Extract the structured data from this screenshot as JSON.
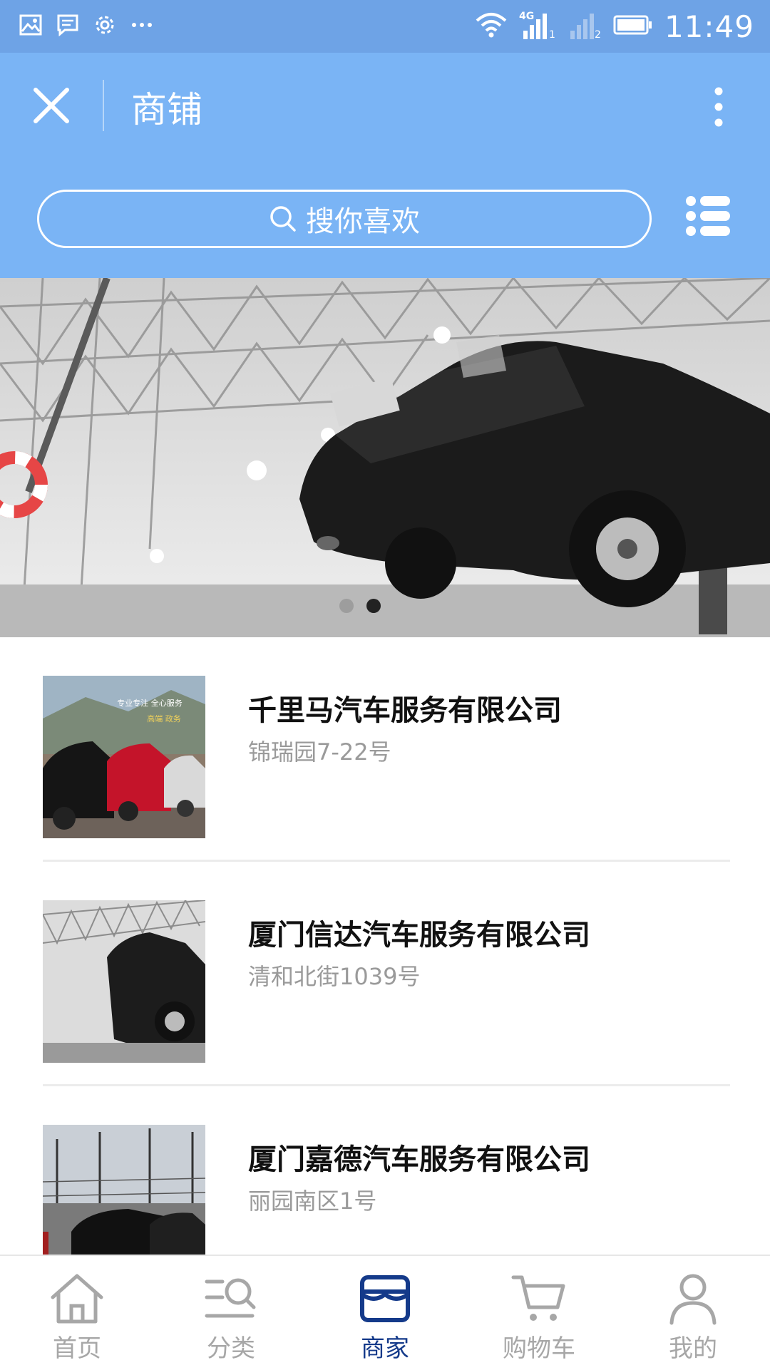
{
  "status_bar": {
    "time": "11:49",
    "network": "4G",
    "sim1": "1",
    "sim2": "2",
    "left_icons": [
      "image-icon",
      "message-icon",
      "gear-icon",
      "more-dots-icon"
    ]
  },
  "header": {
    "title": "商铺",
    "search_placeholder": "搜你喜欢",
    "colors": {
      "header_bg": "#7ab4f5",
      "status_bg": "#6ea3e6"
    }
  },
  "banner": {
    "slides": 2,
    "active_slide": 2
  },
  "shops": [
    {
      "name": "千里马汽车服务有限公司",
      "address": "锦瑞园7-22号",
      "thumb_text": [
        "专业专注 全心服务",
        "高端 政务"
      ]
    },
    {
      "name": "厦门信达汽车服务有限公司",
      "address": "清和北街1039号"
    },
    {
      "name": "厦门嘉德汽车服务有限公司",
      "address": "丽园南区1号"
    }
  ],
  "tabs": [
    {
      "label": "首页",
      "icon": "home-icon",
      "active": false
    },
    {
      "label": "分类",
      "icon": "category-search-icon",
      "active": false
    },
    {
      "label": "商家",
      "icon": "store-icon",
      "active": true
    },
    {
      "label": "购物车",
      "icon": "cart-icon",
      "active": false
    },
    {
      "label": "我的",
      "icon": "user-icon",
      "active": false
    }
  ],
  "colors": {
    "tab_active": "#143a8a",
    "tab_inactive": "#a7a7a7"
  }
}
